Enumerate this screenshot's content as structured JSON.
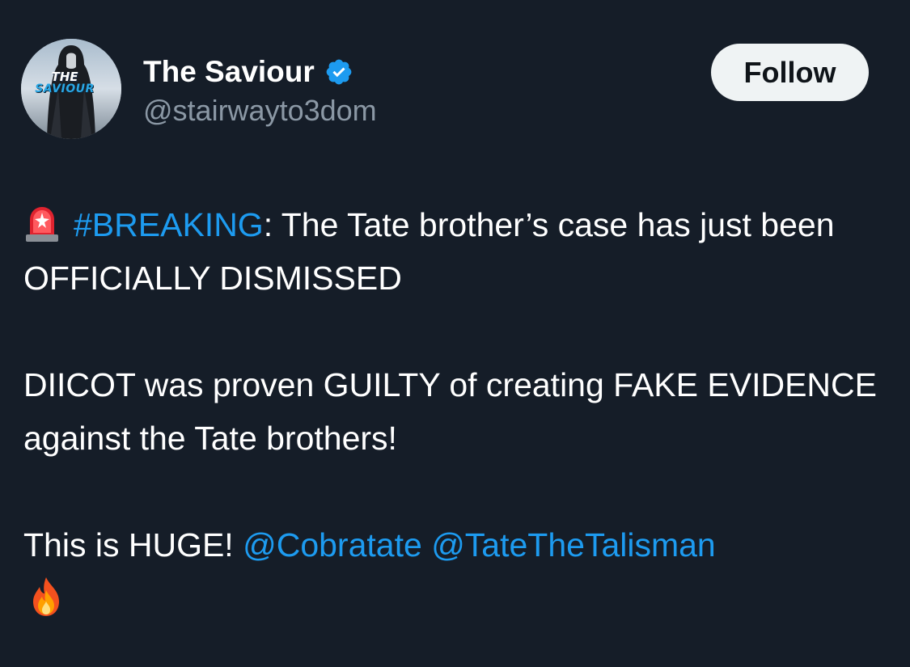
{
  "author": {
    "display_name": "The Saviour",
    "handle": "@stairwayto3dom",
    "verified": true,
    "avatar_text_line1": "THE",
    "avatar_text_line2": "SAVIOUR"
  },
  "follow_button": {
    "label": "Follow"
  },
  "post": {
    "paragraph1": {
      "emoji": "police-siren-light",
      "hashtag": "#BREAKING",
      "text": ": The Tate brother’s case has just been OFFICIALLY DISMISSED"
    },
    "paragraph2": {
      "text": "DIICOT was proven GUILTY of creating FAKE EVIDENCE against the Tate brothers!"
    },
    "paragraph3": {
      "text": "This is HUGE! ",
      "mention1": "@Cobratate",
      "separator": " ",
      "mention2": "@TateTheTalisman",
      "trailing_emoji": "fire"
    }
  },
  "colors": {
    "background": "#151d28",
    "text": "#ffffff",
    "secondary_text": "#8b98a5",
    "link": "#1d9bf0",
    "verified_badge": "#1d9bf0",
    "follow_button_bg": "#eff3f4",
    "follow_button_text": "#0f1419"
  }
}
